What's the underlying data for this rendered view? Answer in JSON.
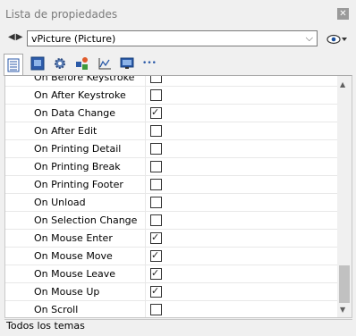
{
  "window": {
    "title": "Lista de propiedades"
  },
  "object_selector": {
    "nav": "◀▶",
    "value": "vPicture (Picture)"
  },
  "toolbar": {
    "icons": [
      "list-icon",
      "object-icon",
      "gear-icon",
      "shapes-icon",
      "chart-icon",
      "display-icon",
      "more-icon"
    ],
    "more_label": "•••"
  },
  "properties": [
    {
      "label": "On Before Keystroke",
      "checked": false
    },
    {
      "label": "On After Keystroke",
      "checked": false
    },
    {
      "label": "On Data Change",
      "checked": true
    },
    {
      "label": "On After Edit",
      "checked": false
    },
    {
      "label": "On Printing Detail",
      "checked": false
    },
    {
      "label": "On Printing Break",
      "checked": false
    },
    {
      "label": "On Printing Footer",
      "checked": false
    },
    {
      "label": "On Unload",
      "checked": false
    },
    {
      "label": "On Selection Change",
      "checked": false
    },
    {
      "label": "On Mouse Enter",
      "checked": true
    },
    {
      "label": "On Mouse Move",
      "checked": true
    },
    {
      "label": "On Mouse Leave",
      "checked": true
    },
    {
      "label": "On Mouse Up",
      "checked": true
    },
    {
      "label": "On Scroll",
      "checked": false
    }
  ],
  "status": {
    "text": "Todos los temas"
  }
}
